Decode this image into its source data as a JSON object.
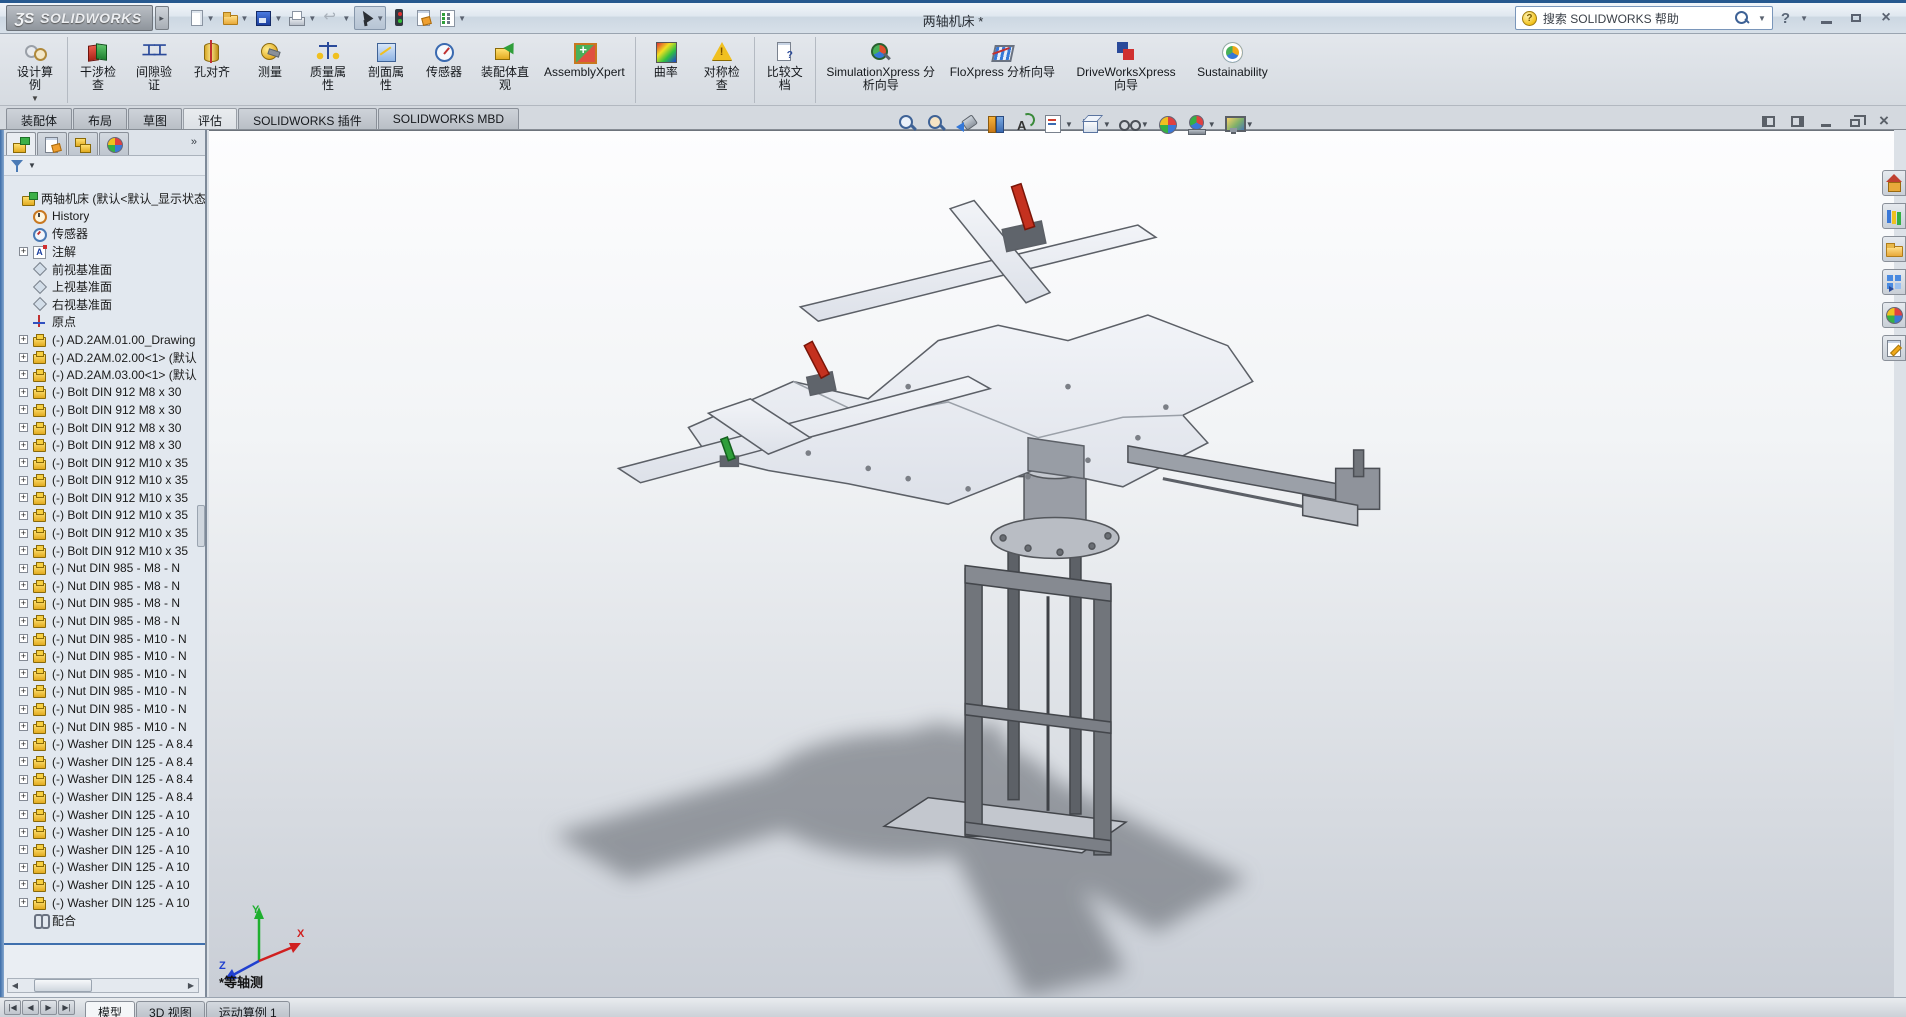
{
  "titlebar": {
    "brand_glyph": "ƷS",
    "brand": "SOLIDWORKS",
    "title": "两轴机床 *",
    "search_text": "搜索 SOLIDWORKS 帮助",
    "quick_tools": [
      {
        "name": "new-document",
        "icocls": "qi-new",
        "btncls": "",
        "dropdown": true
      },
      {
        "name": "open-document",
        "icocls": "qi-open",
        "btncls": "",
        "dropdown": true
      },
      {
        "name": "save-document",
        "icocls": "qi-save",
        "btncls": "",
        "dropdown": true
      },
      {
        "name": "print-document",
        "icocls": "qi-print",
        "btncls": "",
        "dropdown": true
      },
      {
        "name": "undo",
        "icocls": "qi-undo",
        "btncls": "",
        "dropdown": true
      },
      {
        "name": "select",
        "icocls": "qi-select",
        "btncls": "qt-pressed",
        "dropdown": true
      },
      {
        "name": "rebuild",
        "icocls": "qi-rebuild",
        "btncls": "",
        "dropdown": false
      },
      {
        "name": "file-properties",
        "icocls": "qi-fileprops",
        "btncls": "",
        "dropdown": false
      },
      {
        "name": "options",
        "icocls": "qi-options",
        "btncls": "",
        "dropdown": true
      }
    ]
  },
  "ribbon": {
    "buttons": [
      {
        "label": "设计算例",
        "icon": "ri-design-study",
        "cls": "rb-cn",
        "dropdown": true
      },
      {
        "label": "干涉检查",
        "icon": "ri-interference",
        "cls": "rb-cn rb-sep",
        "dropdown": false
      },
      {
        "label": "间隙验证",
        "icon": "ri-clearance",
        "cls": "rb-cn",
        "dropdown": false
      },
      {
        "label": "孔对齐",
        "icon": "ri-hole-align",
        "cls": "rb-cn",
        "dropdown": false
      },
      {
        "label": "测量",
        "icon": "ri-measure",
        "cls": "rb-cn",
        "dropdown": false
      },
      {
        "label": "质量属性",
        "icon": "ri-mass-props",
        "cls": "rb-cn",
        "dropdown": false
      },
      {
        "label": "剖面属性",
        "icon": "ri-section-props",
        "cls": "rb-cn",
        "dropdown": false
      },
      {
        "label": "传感器",
        "icon": "ri-sensor-r",
        "cls": "rb-cn",
        "dropdown": false
      },
      {
        "label": "装配体直观",
        "icon": "ri-assembly-visual",
        "cls": "rb-cn5",
        "dropdown": false
      },
      {
        "label": "AssemblyXpert",
        "icon": "ri-assembly-xpert",
        "cls": "rb-en",
        "dropdown": false
      },
      {
        "label": "曲率",
        "icon": "ri-curvature",
        "cls": "rb-cn rb-sep",
        "dropdown": false
      },
      {
        "label": "对称检查",
        "icon": "ri-symmetry",
        "cls": "rb-cn",
        "dropdown": false
      },
      {
        "label": "比较文档",
        "icon": "ri-compare-docs",
        "cls": "rb-cn rb-sep",
        "dropdown": false
      },
      {
        "label": "SimulationXpress 分析向导",
        "icon": "ri-simx",
        "cls": "rb-en-wide rb-sep",
        "dropdown": false
      },
      {
        "label": "FloXpress 分析向导",
        "icon": "ri-flox",
        "cls": "rb-en-wide",
        "dropdown": false
      },
      {
        "label": "DriveWorksXpress 向导",
        "icon": "ri-dwx",
        "cls": "rb-en-wide",
        "dropdown": false
      },
      {
        "label": "Sustainability",
        "icon": "ri-sustain",
        "cls": "rb-en",
        "dropdown": false
      }
    ]
  },
  "command_tabs": {
    "items": [
      {
        "label": "装配体",
        "cls": ""
      },
      {
        "label": "布局",
        "cls": ""
      },
      {
        "label": "草图",
        "cls": ""
      },
      {
        "label": "评估",
        "cls": "tab-active"
      },
      {
        "label": "SOLIDWORKS 插件",
        "cls": ""
      },
      {
        "label": "SOLIDWORKS MBD",
        "cls": ""
      }
    ]
  },
  "headsup": {
    "buttons": [
      {
        "name": "zoom-to-fit",
        "cls": "hv-mag",
        "dropdown": false
      },
      {
        "name": "zoom-to-area",
        "cls": "hv-mag hv-magarea",
        "dropdown": false
      },
      {
        "name": "previous-view",
        "cls": "hv-prev",
        "dropdown": false
      },
      {
        "name": "section-view",
        "cls": "hv-section",
        "dropdown": false
      },
      {
        "name": "dynamic-annotation-views",
        "cls": "hv-rotA",
        "dropdown": false
      },
      {
        "name": "view-orientation",
        "cls": "hv-sheet",
        "dropdown": true
      },
      {
        "name": "display-style",
        "cls": "hv-cube",
        "dropdown": true
      },
      {
        "name": "hide-show-items",
        "cls": "hv-glasses",
        "dropdown": true
      },
      {
        "name": "edit-appearance",
        "cls": "hv-ball",
        "dropdown": false
      },
      {
        "name": "apply-scene",
        "cls": "hv-scene",
        "dropdown": true
      },
      {
        "name": "view-settings",
        "cls": "hv-monitor",
        "dropdown": true
      }
    ]
  },
  "feature_panel": {
    "overflow_label": "»",
    "panel_tabs": [
      {
        "name": "featuremanager-tree-tab",
        "cls": "pt-fm",
        "tabcls": "pt-active"
      },
      {
        "name": "propertymanager-tab",
        "cls": "pt-pm",
        "tabcls": ""
      },
      {
        "name": "configurationmanager-tab",
        "cls": "pt-cm",
        "tabcls": ""
      },
      {
        "name": "displaymanager-tab",
        "cls": "pt-dm",
        "tabcls": ""
      }
    ],
    "tree": [
      {
        "label": "两轴机床 (默认<默认_显示状态",
        "icon": "ti-assembly",
        "rowcls": "trow-root",
        "expand": false
      },
      {
        "label": "History",
        "icon": "ti-history",
        "rowcls": "",
        "expand": false
      },
      {
        "label": "传感器",
        "icon": "ti-sensor",
        "rowcls": "",
        "expand": false
      },
      {
        "label": "注解",
        "icon": "ti-annotation",
        "rowcls": "",
        "expand": true
      },
      {
        "label": "前视基准面",
        "icon": "ti-plane",
        "rowcls": "",
        "expand": false
      },
      {
        "label": "上视基准面",
        "icon": "ti-plane",
        "rowcls": "",
        "expand": false
      },
      {
        "label": "右视基准面",
        "icon": "ti-plane",
        "rowcls": "",
        "expand": false
      },
      {
        "label": "原点",
        "icon": "ti-origin",
        "rowcls": "",
        "expand": false
      },
      {
        "label": "(-) AD.2AM.01.00_Drawing",
        "icon": "ti-component",
        "rowcls": "",
        "expand": true
      },
      {
        "label": "(-) AD.2AM.02.00<1> (默认",
        "icon": "ti-component",
        "rowcls": "",
        "expand": true
      },
      {
        "label": "(-) AD.2AM.03.00<1> (默认",
        "icon": "ti-component",
        "rowcls": "",
        "expand": true
      },
      {
        "label": "(-) Bolt DIN 912 M8 x 30",
        "icon": "ti-component",
        "rowcls": "",
        "expand": true
      },
      {
        "label": "(-) Bolt DIN 912 M8 x 30",
        "icon": "ti-component",
        "rowcls": "",
        "expand": true
      },
      {
        "label": "(-) Bolt DIN 912 M8 x 30",
        "icon": "ti-component",
        "rowcls": "",
        "expand": true
      },
      {
        "label": "(-) Bolt DIN 912 M8 x 30",
        "icon": "ti-component",
        "rowcls": "",
        "expand": true
      },
      {
        "label": "(-) Bolt DIN 912 M10 x 35",
        "icon": "ti-component",
        "rowcls": "",
        "expand": true
      },
      {
        "label": "(-) Bolt DIN 912 M10 x 35",
        "icon": "ti-component",
        "rowcls": "",
        "expand": true
      },
      {
        "label": "(-) Bolt DIN 912 M10 x 35",
        "icon": "ti-component",
        "rowcls": "",
        "expand": true
      },
      {
        "label": "(-) Bolt DIN 912 M10 x 35",
        "icon": "ti-component",
        "rowcls": "",
        "expand": true
      },
      {
        "label": "(-) Bolt DIN 912 M10 x 35",
        "icon": "ti-component",
        "rowcls": "",
        "expand": true
      },
      {
        "label": "(-) Bolt DIN 912 M10 x 35",
        "icon": "ti-component",
        "rowcls": "",
        "expand": true
      },
      {
        "label": "(-) Nut DIN 985 - M8 - N",
        "icon": "ti-component",
        "rowcls": "",
        "expand": true
      },
      {
        "label": "(-) Nut DIN 985 - M8 - N",
        "icon": "ti-component",
        "rowcls": "",
        "expand": true
      },
      {
        "label": "(-) Nut DIN 985 - M8 - N",
        "icon": "ti-component",
        "rowcls": "",
        "expand": true
      },
      {
        "label": "(-) Nut DIN 985 - M8 - N",
        "icon": "ti-component",
        "rowcls": "",
        "expand": true
      },
      {
        "label": "(-) Nut DIN 985 - M10 - N",
        "icon": "ti-component",
        "rowcls": "",
        "expand": true
      },
      {
        "label": "(-) Nut DIN 985 - M10 - N",
        "icon": "ti-component",
        "rowcls": "",
        "expand": true
      },
      {
        "label": "(-) Nut DIN 985 - M10 - N",
        "icon": "ti-component",
        "rowcls": "",
        "expand": true
      },
      {
        "label": "(-) Nut DIN 985 - M10 - N",
        "icon": "ti-component",
        "rowcls": "",
        "expand": true
      },
      {
        "label": "(-) Nut DIN 985 - M10 - N",
        "icon": "ti-component",
        "rowcls": "",
        "expand": true
      },
      {
        "label": "(-) Nut DIN 985 - M10 - N",
        "icon": "ti-component",
        "rowcls": "",
        "expand": true
      },
      {
        "label": "(-) Washer DIN 125 - A 8.4",
        "icon": "ti-component",
        "rowcls": "",
        "expand": true
      },
      {
        "label": "(-) Washer DIN 125 - A 8.4",
        "icon": "ti-component",
        "rowcls": "",
        "expand": true
      },
      {
        "label": "(-) Washer DIN 125 - A 8.4",
        "icon": "ti-component",
        "rowcls": "",
        "expand": true
      },
      {
        "label": "(-) Washer DIN 125 - A 8.4",
        "icon": "ti-component",
        "rowcls": "",
        "expand": true
      },
      {
        "label": "(-) Washer DIN 125 - A 10",
        "icon": "ti-component",
        "rowcls": "",
        "expand": true
      },
      {
        "label": "(-) Washer DIN 125 - A 10",
        "icon": "ti-component",
        "rowcls": "",
        "expand": true
      },
      {
        "label": "(-) Washer DIN 125 - A 10",
        "icon": "ti-component",
        "rowcls": "",
        "expand": true
      },
      {
        "label": "(-) Washer DIN 125 - A 10",
        "icon": "ti-component",
        "rowcls": "",
        "expand": true
      },
      {
        "label": "(-) Washer DIN 125 - A 10",
        "icon": "ti-component",
        "rowcls": "",
        "expand": true
      },
      {
        "label": "(-) Washer DIN 125 - A 10",
        "icon": "ti-component",
        "rowcls": "",
        "expand": true
      },
      {
        "label": "配合",
        "icon": "ti-mates",
        "rowcls": "",
        "expand": false
      }
    ]
  },
  "viewport": {
    "view_label": "*等轴测",
    "triad": {
      "x": "X",
      "y": "Y",
      "z": "Z"
    }
  },
  "taskpane": {
    "buttons": [
      {
        "name": "solidworks-resources",
        "cls": "tp-home"
      },
      {
        "name": "design-library",
        "cls": "tp-library"
      },
      {
        "name": "file-explorer",
        "cls": "tp-folder"
      },
      {
        "name": "view-palette",
        "cls": "tp-palette"
      },
      {
        "name": "appearances-scenes",
        "cls": "tp-appearance"
      },
      {
        "name": "custom-properties",
        "cls": "tp-props"
      }
    ]
  },
  "bottombar": {
    "vcr": [
      "|◀",
      "◀",
      "▶",
      "▶|"
    ],
    "tabs": [
      {
        "label": "模型",
        "cls": "tab-active"
      },
      {
        "label": "3D 视图",
        "cls": ""
      },
      {
        "label": "运动算例 1",
        "cls": ""
      }
    ]
  },
  "colors": {
    "accent_blue": "#27598f",
    "panel_bg": "#e2e8ef",
    "viewport_top": "#fdfdfe",
    "viewport_bottom": "#c9ced6",
    "clamp_red": "#c4311f",
    "steel_gray": "#71757b",
    "plate_gray": "#e9ecf2"
  }
}
